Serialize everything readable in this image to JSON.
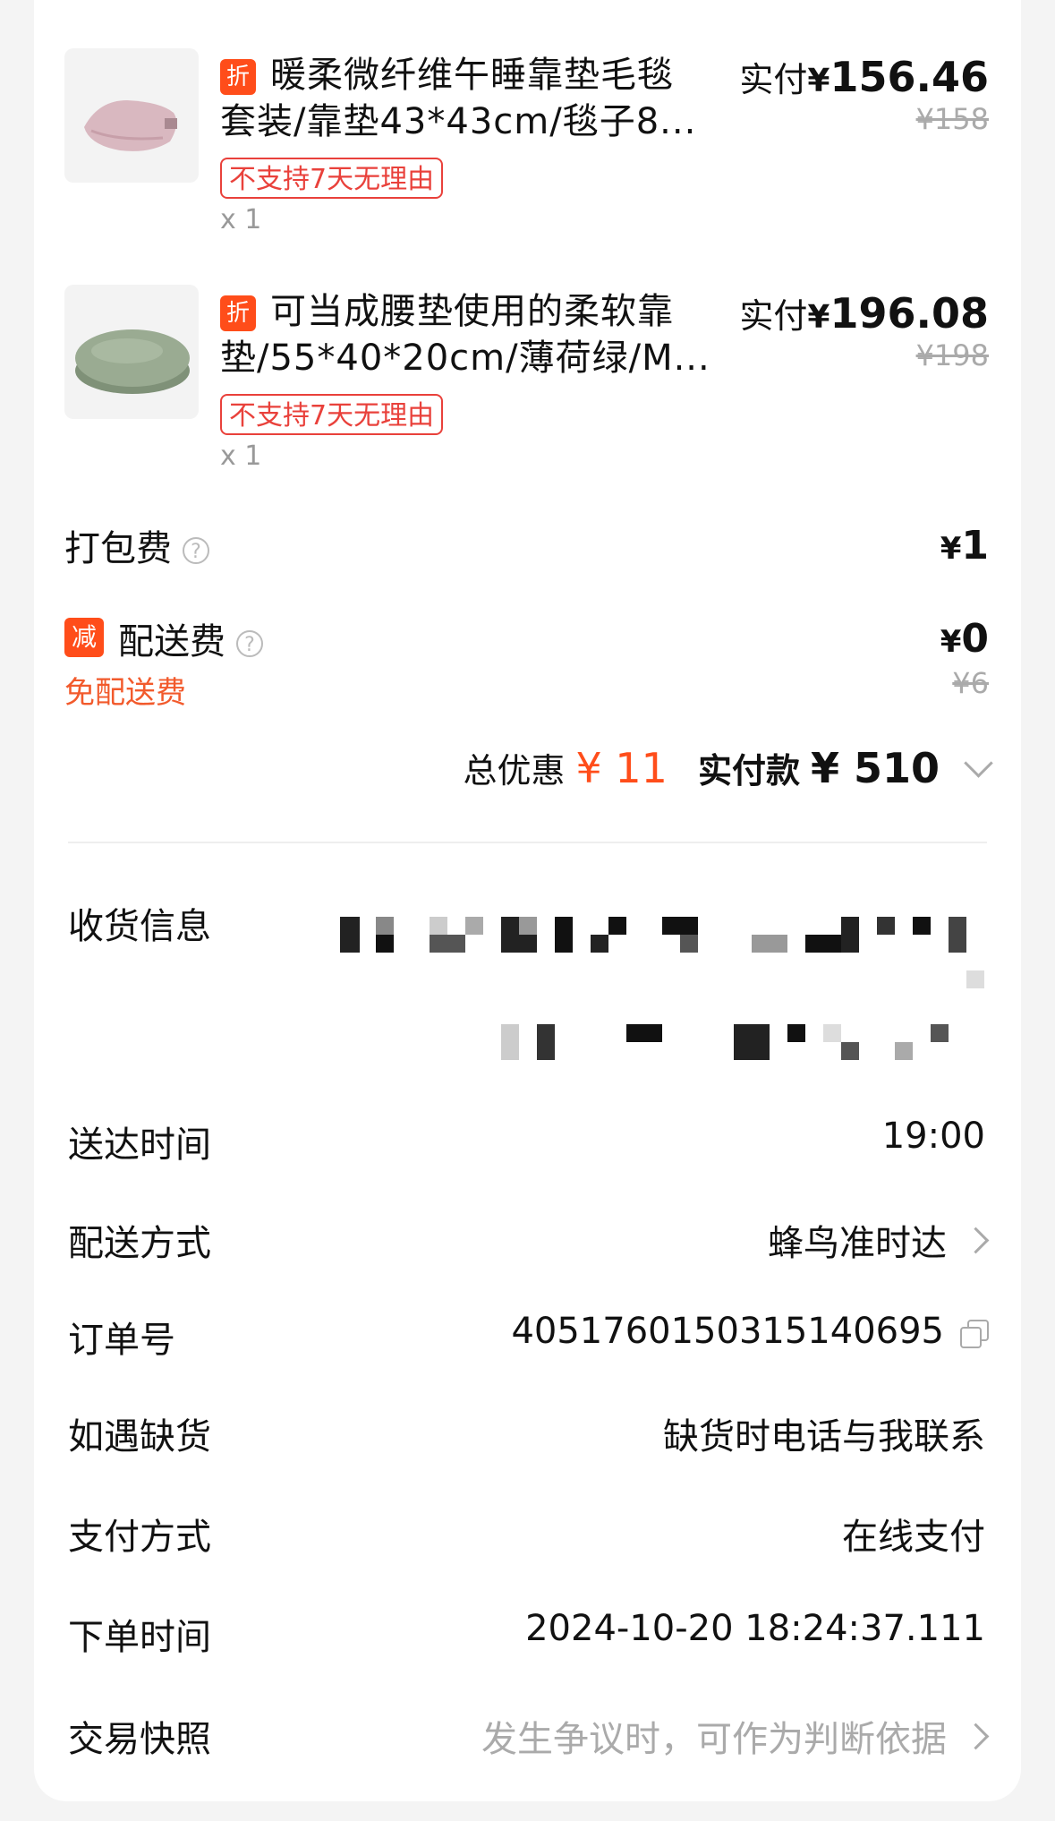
{
  "items": [
    {
      "discount_tag": "折",
      "title_line1": "暖柔微纤维午睡靠垫毛毯",
      "title_line2": "套装/靠垫43*43cm/毯子8...",
      "badge": "不支持7天无理由",
      "qty": "x 1",
      "paid_label": "实付",
      "currency": "¥",
      "paid": "156.46",
      "original": "¥158"
    },
    {
      "discount_tag": "折",
      "title_line1": "可当成腰垫使用的柔软靠",
      "title_line2": "垫/55*40*20cm/薄荷绿/M...",
      "badge": "不支持7天无理由",
      "qty": "x 1",
      "paid_label": "实付",
      "currency": "¥",
      "paid": "196.08",
      "original": "¥198"
    }
  ],
  "fees": {
    "packing_label": "打包费",
    "packing_currency": "¥",
    "packing_value": "1",
    "delivery_tag": "减",
    "delivery_label": "配送费",
    "delivery_currency": "¥",
    "delivery_value": "0",
    "delivery_original": "¥6",
    "free_delivery_text": "免配送费",
    "help_glyph": "?"
  },
  "totals": {
    "discount_label": "总优惠",
    "discount_value": "¥ 11",
    "paid_label": "实付款",
    "paid_value": "¥ 510"
  },
  "info": {
    "address_label": "收货信息",
    "delivery_time_label": "送达时间",
    "delivery_time": "19:00",
    "delivery_method_label": "配送方式",
    "delivery_method": "蜂鸟准时达",
    "order_no_label": "订单号",
    "order_no": "4051760150315140695",
    "out_of_stock_label": "如遇缺货",
    "out_of_stock": "缺货时电话与我联系",
    "payment_label": "支付方式",
    "payment": "在线支付",
    "order_time_label": "下单时间",
    "order_time": "2024-10-20 18:24:37.111",
    "snapshot_label": "交易快照",
    "snapshot": "发生争议时，可作为判断依据"
  },
  "colors": {
    "accent": "#ff4d1a",
    "badge_red": "#e9413b",
    "free_delivery": "#f25a2c",
    "muted": "#aaaaaa"
  },
  "icons": [
    "discount-tag-icon",
    "help-circle-icon",
    "chevron-down-icon",
    "chevron-right-icon",
    "copy-icon"
  ]
}
